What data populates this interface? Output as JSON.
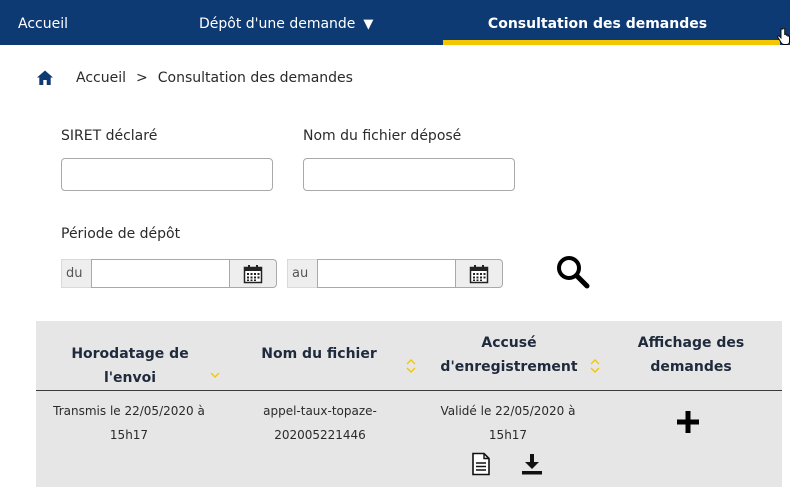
{
  "nav": {
    "home_label": "Accueil",
    "depot_label": "Dépôt d'une demande",
    "depot_caret": "▼",
    "consult_label": "Consultation des demandes"
  },
  "breadcrumb": {
    "home": "Accueil",
    "separator": ">",
    "current": "Consultation des demandes"
  },
  "form": {
    "siret_label": "SIRET déclaré",
    "siret_value": "",
    "filename_label": "Nom du fichier déposé",
    "filename_value": "",
    "period_label": "Période de dépôt",
    "from_prefix": "du",
    "from_value": "",
    "to_prefix": "au",
    "to_value": ""
  },
  "table": {
    "headers": {
      "timestamp": "Horodatage de l'envoi",
      "filename": "Nom du fichier",
      "receipt_line1": "Accusé",
      "receipt_line2": "d'enregistrement",
      "display_line1": "Affichage des",
      "display_line2": "demandes"
    },
    "rows": [
      {
        "timestamp_line1": "Transmis le 22/05/2020 à",
        "timestamp_line2": "15h17",
        "filename_line1": "appel-taux-topaze-",
        "filename_line2": "202005221446",
        "receipt_line1": "Validé le 22/05/2020 à",
        "receipt_line2": "15h17"
      }
    ]
  },
  "colors": {
    "nav_bg": "#0e3a73",
    "accent_yellow": "#f3c600",
    "table_bg": "#e6e6e6"
  },
  "icons": [
    "home-icon",
    "calendar-icon",
    "search-icon",
    "sort-icon",
    "plus-icon",
    "document-icon",
    "download-icon",
    "cursor-hand-icon"
  ]
}
